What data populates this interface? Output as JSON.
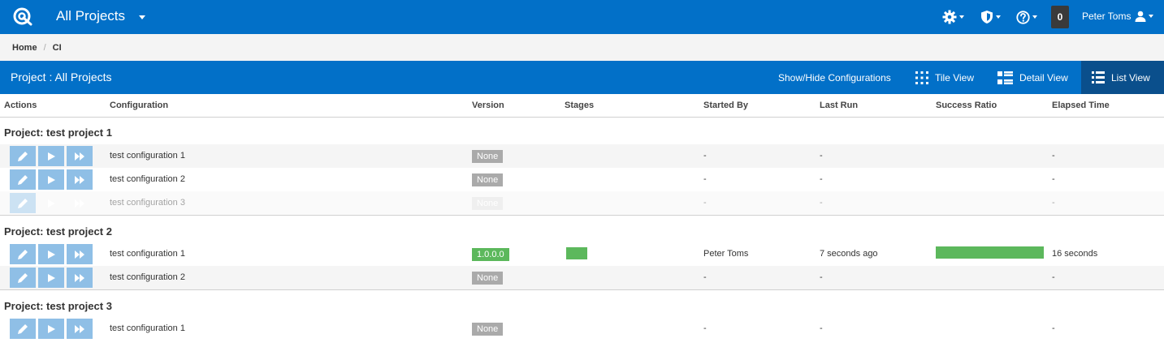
{
  "header": {
    "title": "All Projects",
    "counter": "0",
    "user_name": "Peter Toms",
    "icons": [
      "gear-icon",
      "shield-icon",
      "help-icon",
      "user-icon"
    ]
  },
  "breadcrumb": {
    "home": "Home",
    "current": "CI"
  },
  "project_bar": {
    "title": "Project : All Projects",
    "show_hide": "Show/Hide Configurations",
    "tile_view": "Tile View",
    "detail_view": "Detail View",
    "list_view": "List View"
  },
  "columns": {
    "actions": "Actions",
    "configuration": "Configuration",
    "version": "Version",
    "stages": "Stages",
    "started_by": "Started By",
    "last_run": "Last Run",
    "success_ratio": "Success Ratio",
    "elapsed_time": "Elapsed Time"
  },
  "groups": [
    {
      "title": "Project: test project 1",
      "rows": [
        {
          "configuration": "test configuration 1",
          "version": "None",
          "started_by": "-",
          "last_run": "-",
          "elapsed": "-"
        },
        {
          "configuration": "test configuration 2",
          "version": "None",
          "started_by": "-",
          "last_run": "-",
          "elapsed": "-"
        },
        {
          "configuration": "test configuration 3",
          "version": "None",
          "started_by": "-",
          "last_run": "-",
          "elapsed": "-"
        }
      ]
    },
    {
      "title": "Project: test project 2",
      "rows": [
        {
          "configuration": "test configuration 1",
          "version": "1.0.0.0",
          "started_by": "Peter Toms",
          "last_run": "7 seconds ago",
          "elapsed": "16 seconds",
          "success_ratio": 1.0
        },
        {
          "configuration": "test configuration 2",
          "version": "None",
          "started_by": "-",
          "last_run": "-",
          "elapsed": "-"
        }
      ]
    },
    {
      "title": "Project: test project 3",
      "rows": [
        {
          "configuration": "test configuration 1",
          "version": "None",
          "started_by": "-",
          "last_run": "-",
          "elapsed": "-"
        }
      ]
    }
  ],
  "colors": {
    "brand": "#0270c8",
    "success": "#5cb85c",
    "action_button": "#8fbfe6",
    "none_badge": "#aaaaaa"
  }
}
